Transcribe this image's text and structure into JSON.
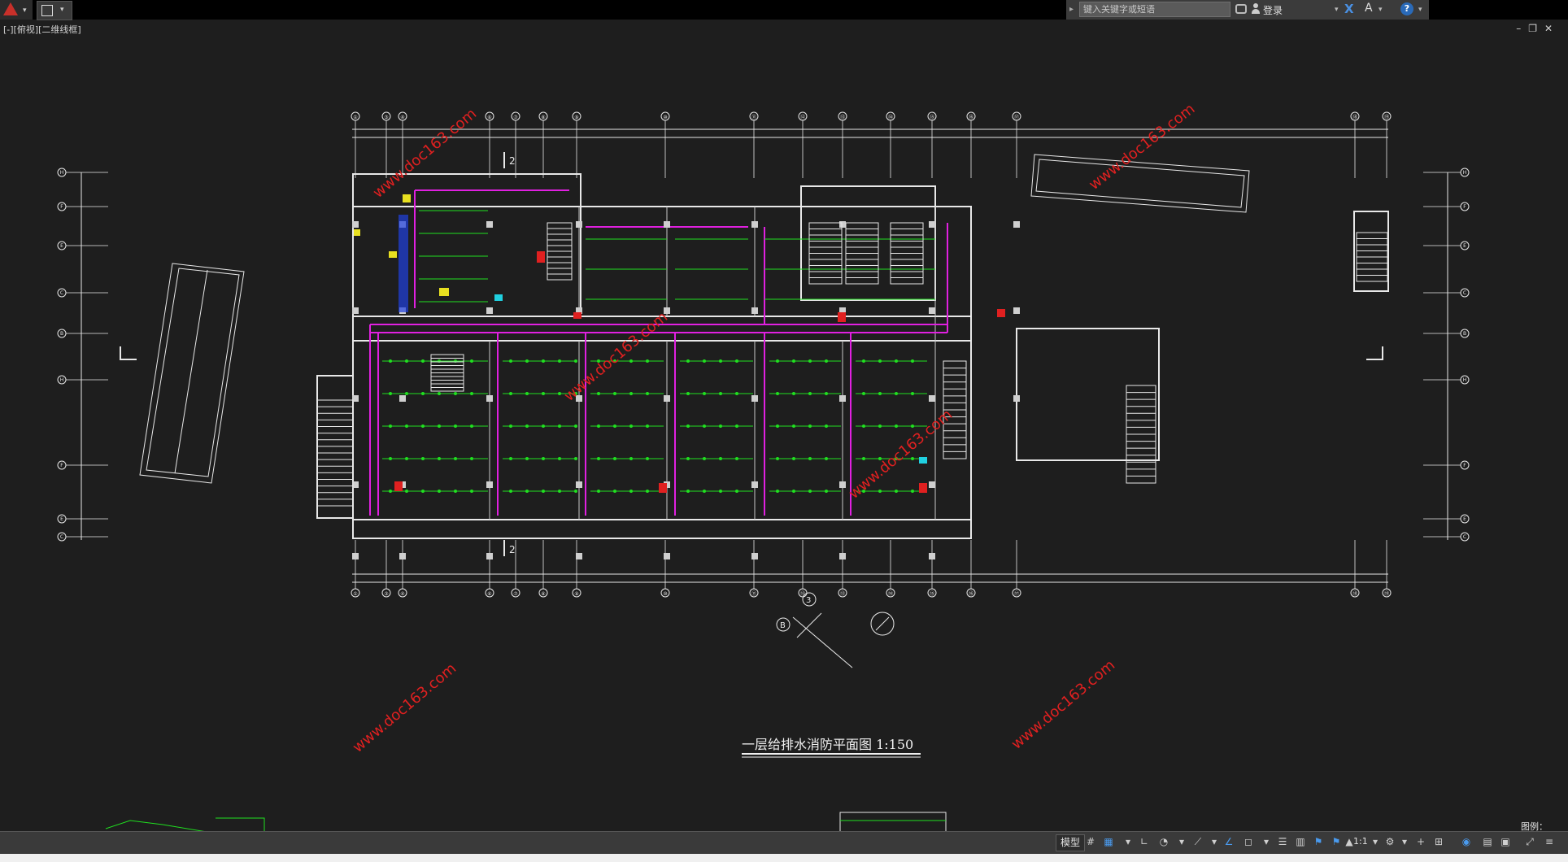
{
  "titlebar": {
    "search_placeholder": "键入关键字或短语",
    "login_label": "登录"
  },
  "viewport": {
    "view_label": "[-][俯视][二维线框]"
  },
  "drawing": {
    "title": "一层给排水消防平面图 1:150",
    "watermark": "www.doc163.com",
    "section_mark": "2",
    "north_label": "B",
    "north_number": "3",
    "grid_top": [
      "①",
      "③",
      "④",
      "⑥",
      "⑦",
      "⑧",
      "⑨",
      "⑩",
      "⑪",
      "⑫",
      "⑬",
      "⑭",
      "⑮",
      "⑯",
      "⑰",
      "⑱",
      "⑲"
    ],
    "grid_side": [
      "H",
      "F",
      "E",
      "C",
      "B"
    ],
    "legend_label": "图例："
  },
  "statusbar": {
    "model_label": "模型",
    "scale_label": "1:1"
  },
  "colors": {
    "background": "#1e1e1e",
    "pipe_magenta": "#e020e0",
    "pipe_green": "#20e020",
    "wall_white": "#e8e8e8",
    "accent_red": "#e02020",
    "accent_yellow": "#e8e020",
    "accent_blue": "#2040e0",
    "accent_cyan": "#20d0e0"
  }
}
